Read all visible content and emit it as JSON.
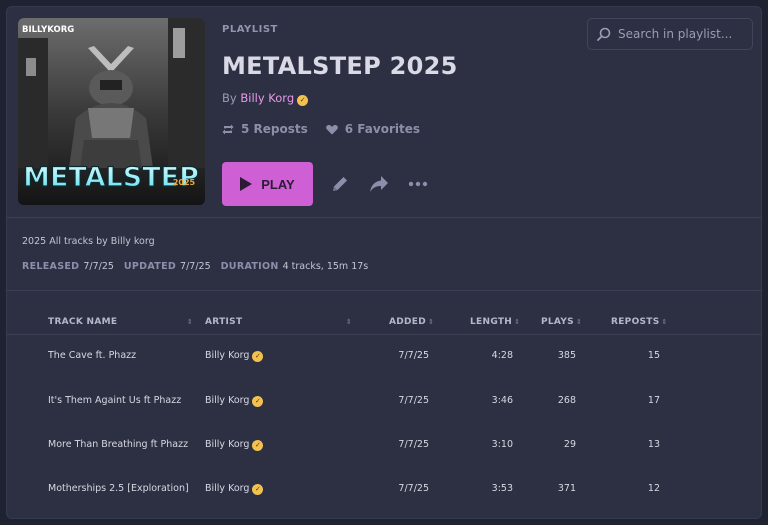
{
  "header": {
    "kind": "PLAYLIST",
    "title": "METALSTEP 2025",
    "by_prefix": "By",
    "artist": "Billy Korg",
    "reposts": "5 Reposts",
    "favorites": "6 Favorites",
    "play_label": "PLAY",
    "cover_brand": "BILLYKORG",
    "cover_title": "METALSTEP",
    "cover_year": "2025"
  },
  "search": {
    "placeholder": "Search in playlist..."
  },
  "details": {
    "description": "2025 All tracks by Billy korg",
    "released_label": "RELEASED",
    "released": "7/7/25",
    "updated_label": "UPDATED",
    "updated": "7/7/25",
    "duration_label": "DURATION",
    "duration": "4 tracks, 15m 17s"
  },
  "table": {
    "columns": {
      "name": "TRACK NAME",
      "artist": "ARTIST",
      "added": "ADDED",
      "length": "LENGTH",
      "plays": "PLAYS",
      "reposts": "REPOSTS"
    },
    "rows": [
      {
        "name": "The Cave ft. Phazz",
        "artist": "Billy Korg",
        "added": "7/7/25",
        "length": "4:28",
        "plays": "385",
        "reposts": "15"
      },
      {
        "name": "It's Them Againt Us ft Phazz",
        "artist": "Billy Korg",
        "added": "7/7/25",
        "length": "3:46",
        "plays": "268",
        "reposts": "17"
      },
      {
        "name": "More Than Breathing ft Phazz",
        "artist": "Billy Korg",
        "added": "7/7/25",
        "length": "3:10",
        "plays": "29",
        "reposts": "13"
      },
      {
        "name": "Motherships 2.5 [Exploration]",
        "artist": "Billy Korg",
        "added": "7/7/25",
        "length": "3:53",
        "plays": "371",
        "reposts": "12"
      }
    ]
  },
  "colors": {
    "accent": "#cf5fd4",
    "artist_link": "#e79ae9",
    "card": "#2d3042",
    "background": "#1f2230"
  },
  "icons": [
    "repost-icon",
    "heart-icon",
    "play-icon",
    "pencil-icon",
    "share-icon",
    "more-icon",
    "search-icon",
    "verified-badge-icon",
    "sort-icon"
  ]
}
